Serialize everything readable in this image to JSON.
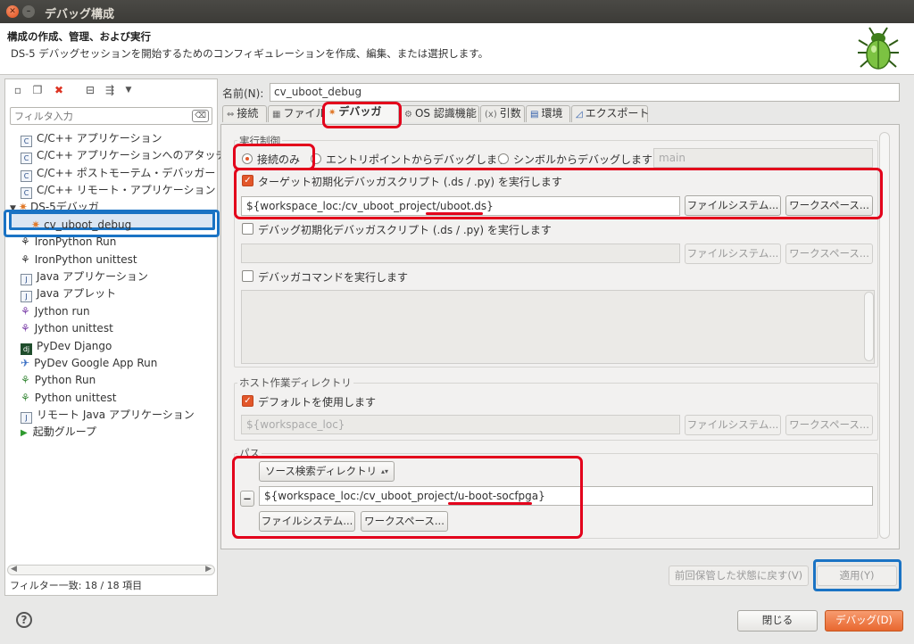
{
  "window": {
    "title": "デバッグ構成"
  },
  "header": {
    "title": "構成の作成、管理、および実行",
    "description": "DS-5 デバッグセッションを開始するためのコンフィギュレーションを作成、編集、または選択します。",
    "icon": "bug-icon"
  },
  "sidebar": {
    "filter_placeholder": "フィルタ入力",
    "filter_clear": "⌫",
    "items": [
      {
        "label": "C/C++ アプリケーション",
        "icon": "c-app-icon"
      },
      {
        "label": "C/C++ アプリケーションへのアタッチ",
        "icon": "c-attach-icon"
      },
      {
        "label": "C/C++ ポストモーテム・デバッガー",
        "icon": "c-postmortem-icon"
      },
      {
        "label": "C/C++ リモート・アプリケーション",
        "icon": "c-remote-icon"
      },
      {
        "label": "DS-5デバッガ",
        "icon": "ds5-debugger-icon"
      },
      {
        "label": "cv_uboot_debug",
        "icon": "debug-config-icon"
      },
      {
        "label": "IronPython Run",
        "icon": "python-run-icon"
      },
      {
        "label": "IronPython unittest",
        "icon": "python-unittest-icon"
      },
      {
        "label": "Java アプリケーション",
        "icon": "java-app-icon"
      },
      {
        "label": "Java アプレット",
        "icon": "java-applet-icon"
      },
      {
        "label": "Jython run",
        "icon": "jython-run-icon"
      },
      {
        "label": "Jython unittest",
        "icon": "jython-unittest-icon"
      },
      {
        "label": "PyDev Django",
        "icon": "django-icon"
      },
      {
        "label": "PyDev Google App Run",
        "icon": "google-app-icon"
      },
      {
        "label": "Python Run",
        "icon": "python-run-icon"
      },
      {
        "label": "Python unittest",
        "icon": "python-unittest-icon"
      },
      {
        "label": "リモート Java アプリケーション",
        "icon": "remote-java-icon"
      },
      {
        "label": "起動グループ",
        "icon": "launch-group-icon"
      }
    ],
    "filter_status": "フィルター一致: 18 / 18 項目"
  },
  "config": {
    "name_label": "名前(N):",
    "name_value": "cv_uboot_debug",
    "tabs": [
      {
        "label": "接続",
        "icon": "connection-icon"
      },
      {
        "label": "ファイル",
        "icon": "file-icon"
      },
      {
        "label": "デバッガ",
        "icon": "debugger-icon"
      },
      {
        "label": "OS 認識機能",
        "icon": "os-icon"
      },
      {
        "label": "引数",
        "icon": "arguments-icon"
      },
      {
        "label": "環境",
        "icon": "environment-icon"
      },
      {
        "label": "エクスポート",
        "icon": "export-icon"
      }
    ],
    "run_control": {
      "label": "実行制御",
      "opt_connect": "接続のみ",
      "opt_entry": "エントリポイントからデバッグします",
      "opt_symbol": "シンボルからデバッグします",
      "symbol_value": "main",
      "target_script_label": "ターゲット初期化デバッガスクリプト (.ds / .py) を実行します",
      "target_script_value": "${workspace_loc:/cv_uboot_project/uboot.ds}",
      "debug_script_label": "デバッグ初期化デバッガスクリプト (.ds / .py) を実行します",
      "debug_cmd_label": "デバッガコマンドを実行します",
      "filesystem_btn": "ファイルシステム...",
      "workspace_btn": "ワークスペース..."
    },
    "host_dir": {
      "label": "ホスト作業ディレクトリ",
      "use_default": "デフォルトを使用します",
      "value": "${workspace_loc}",
      "filesystem_btn": "ファイルシステム...",
      "workspace_btn": "ワークスペース..."
    },
    "paths": {
      "label": "パス",
      "source_select": "ソース検索ディレクトリ",
      "remove_btn": "−",
      "value": "${workspace_loc:/cv_uboot_project/u-boot-socfpga}",
      "filesystem_btn": "ファイルシステム...",
      "workspace_btn": "ワークスペース..."
    },
    "revert_btn": "前回保管した状態に戻す(V)",
    "apply_btn": "適用(Y)"
  },
  "footer": {
    "help": "?",
    "close_btn": "閉じる",
    "debug_btn": "デバッグ(D)"
  },
  "colors": {
    "accent": "#e8672f",
    "annotation_red": "#e3001b",
    "annotation_blue": "#1a73c4"
  }
}
